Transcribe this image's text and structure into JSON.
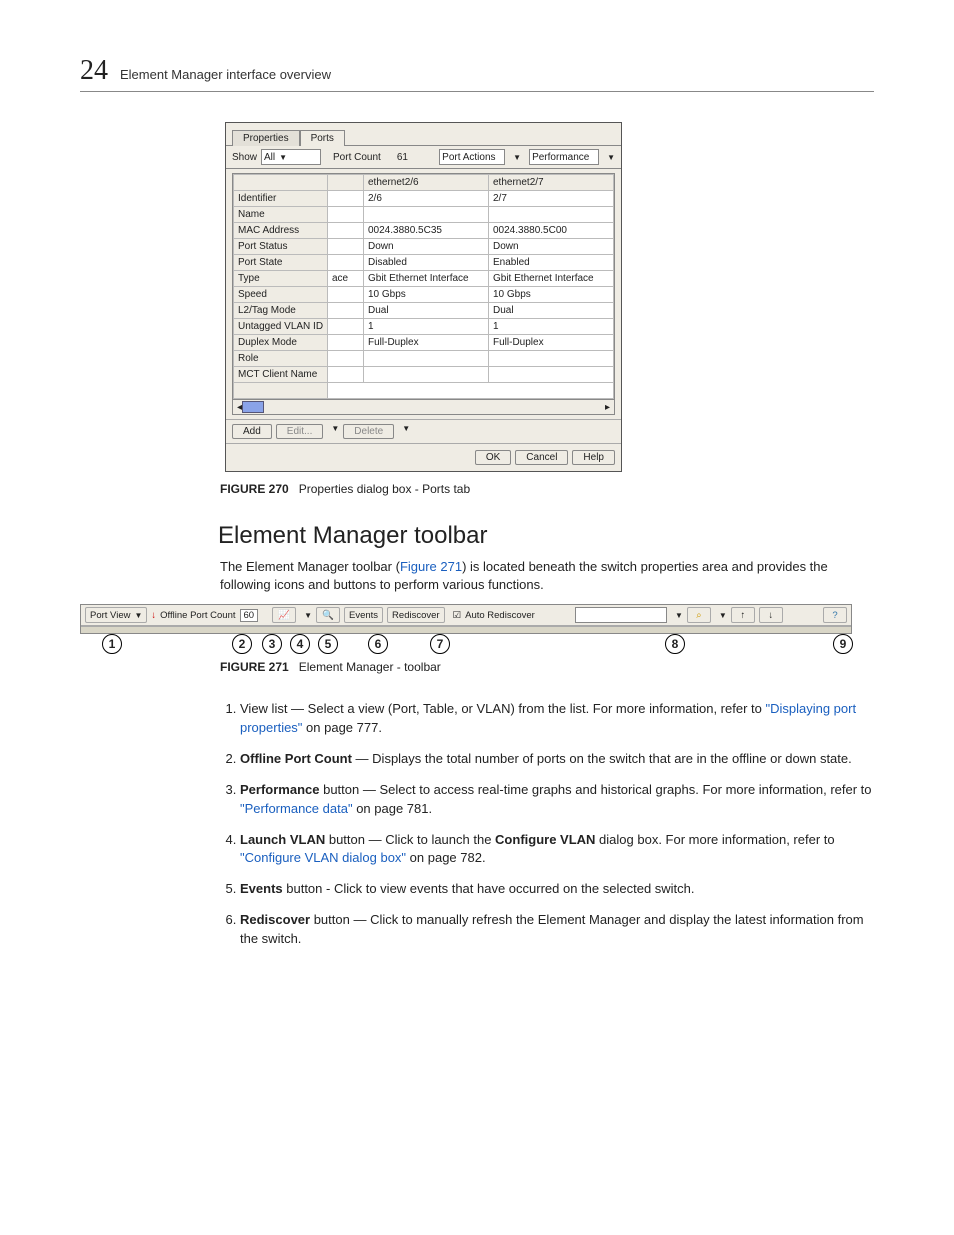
{
  "header": {
    "page_number": "24",
    "section": "Element Manager interface overview"
  },
  "dialog": {
    "tabs": [
      "Properties",
      "Ports"
    ],
    "show_label": "Show",
    "show_value": "All",
    "port_count_label": "Port Count",
    "port_count_value": "61",
    "port_actions_label": "Port Actions",
    "performance_label": "Performance",
    "col_headers": [
      "",
      "ethernet2/6",
      "ethernet2/7"
    ],
    "rows": [
      [
        "Identifier",
        "2/6",
        "2/7"
      ],
      [
        "Name",
        "",
        ""
      ],
      [
        "MAC Address",
        "0024.3880.5C35",
        "0024.3880.5C00"
      ],
      [
        "Port Status",
        "Down",
        "Down"
      ],
      [
        "Port State",
        "Disabled",
        "Enabled"
      ],
      [
        "Type",
        "Gbit Ethernet Interface",
        "Gbit Ethernet Interface"
      ],
      [
        "Speed",
        "10 Gbps",
        "10 Gbps"
      ],
      [
        "L2/Tag Mode",
        "Dual",
        "Dual"
      ],
      [
        "Untagged VLAN ID",
        "1",
        "1"
      ],
      [
        "Duplex Mode",
        "Full-Duplex",
        "Full-Duplex"
      ],
      [
        "Role",
        "",
        ""
      ],
      [
        "MCT Client Name",
        "",
        ""
      ]
    ],
    "midcell_frag": "ace",
    "add": "Add",
    "edit": "Edit...",
    "delete": "Delete",
    "ok": "OK",
    "cancel": "Cancel",
    "help": "Help"
  },
  "fig270": {
    "label": "FIGURE 270",
    "caption": "Properties dialog box - Ports tab"
  },
  "section2": {
    "title": "Element Manager toolbar",
    "para_pre": "The Element Manager toolbar (",
    "para_link": "Figure 271",
    "para_post": ") is located beneath the switch properties area and provides the following icons and buttons to perform various functions."
  },
  "toolbar": {
    "port_view": "Port View",
    "offline_label": "Offline Port Count",
    "offline_value": "60",
    "events": "Events",
    "rediscover": "Rediscover",
    "auto_rediscover": "Auto Rediscover"
  },
  "callouts": [
    "1",
    "2",
    "3",
    "4",
    "5",
    "6",
    "7",
    "8",
    "9"
  ],
  "fig271": {
    "label": "FIGURE 271",
    "caption": "Element Manager - toolbar"
  },
  "list": {
    "i1a": "View list — Select a view (Port, Table, or VLAN) from the list. For more information, refer to ",
    "i1link": "\"Displaying port properties\"",
    "i1b": " on page 777.",
    "i2b": "Offline Port Count",
    "i2a": " — Displays the total number of ports on the switch that are in the offline or down state.",
    "i3b": "Performance",
    "i3a": " button — Select to access real-time graphs and historical graphs. For more information, refer to ",
    "i3link": "\"Performance data\"",
    "i3c": " on page 781.",
    "i4b1": "Launch VLAN",
    "i4a1": " button — Click to launch the ",
    "i4b2": "Configure VLAN",
    "i4a2": " dialog box. For more information, refer to ",
    "i4link": "\"Configure VLAN dialog box\"",
    "i4c": " on page 782.",
    "i5b": "Events",
    "i5a": " button - Click to view events that have occurred on the selected switch.",
    "i6b": "Rediscover",
    "i6a": " button — Click to manually refresh the Element Manager and display the latest information from the switch."
  }
}
